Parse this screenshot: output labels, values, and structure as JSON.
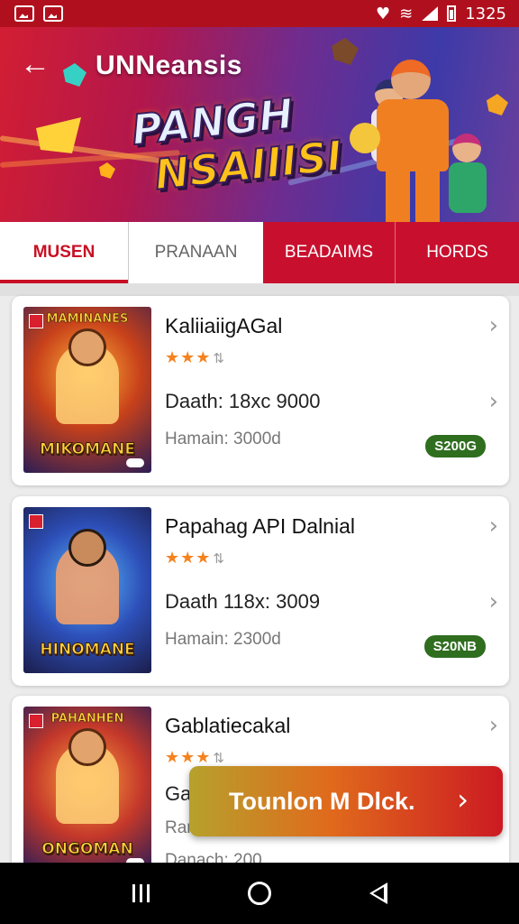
{
  "status_bar": {
    "time": "1325",
    "icons": [
      "gallery-icon",
      "image-icon",
      "notification-icon",
      "wifi-icon",
      "signal-icon",
      "battery-icon"
    ]
  },
  "header": {
    "title": "UNNeansis",
    "back_icon": "arrow-left-icon"
  },
  "banner": {
    "logo_line1": "PANGH",
    "logo_line2": "NSAIIISI",
    "logo_badge": "S"
  },
  "tabs": [
    {
      "label": "MUSEN",
      "active": true
    },
    {
      "label": "PRANAAN",
      "active": false
    },
    {
      "label": "BEADAIMS",
      "active": false
    },
    {
      "label": "HORDS",
      "active": false
    }
  ],
  "items": [
    {
      "title": "KaliiaiigAGal",
      "stars": "★★★",
      "rating_extra": "⇅",
      "detail": "Daath: 18xc 9000",
      "sub": "Hamain: 3000d",
      "price": "S200G",
      "cover_title": "MIKOMANE",
      "cover_top": "MAMINANES"
    },
    {
      "title": "Papahag API Dalnial",
      "stars": "★★★",
      "rating_extra": "⇅",
      "detail": "Daath 118x: 3009",
      "sub": "Hamain: 2300d",
      "price": "S20NB",
      "cover_title": "HINOMANE",
      "cover_top": ""
    },
    {
      "title": "Gablatiecakal",
      "stars": "★★★",
      "rating_extra": "⇅",
      "detail": "Ga",
      "sub": "Ran",
      "sub2": "Danach: 200",
      "price": "",
      "cover_title": "ONGOMAN",
      "cover_top": "PAHANHEN"
    }
  ],
  "cta": {
    "label": "Tounlon M Dlck."
  },
  "colors": {
    "brand_red": "#c8102e",
    "price_green": "#2f6d1f",
    "star_orange": "#f5821f"
  }
}
